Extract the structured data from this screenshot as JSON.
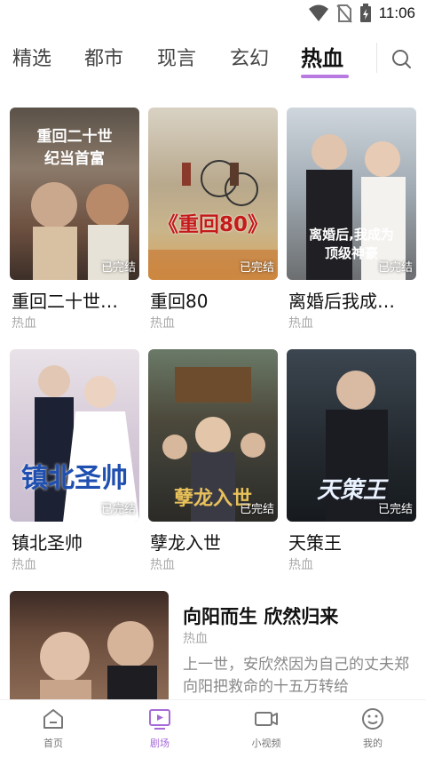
{
  "status": {
    "time": "11:06"
  },
  "tabs": [
    {
      "label": "精选"
    },
    {
      "label": "都市"
    },
    {
      "label": "现言"
    },
    {
      "label": "玄幻"
    },
    {
      "label": "热血"
    }
  ],
  "grid": [
    {
      "title": "重回二十世…",
      "tag": "热血",
      "badge": "已完结",
      "poster_text": "重回二十世纪当首富"
    },
    {
      "title": "重回80",
      "tag": "热血",
      "badge": "已完结",
      "poster_text": "《重回80》"
    },
    {
      "title": "离婚后我成…",
      "tag": "热血",
      "badge": "已完结",
      "poster_text": "离婚后,我成为顶级神豪"
    },
    {
      "title": "镇北圣帅",
      "tag": "热血",
      "badge": "已完结",
      "poster_text": "镇北圣帅"
    },
    {
      "title": "孽龙入世",
      "tag": "热血",
      "badge": "已完结",
      "poster_text": "孽龙入世"
    },
    {
      "title": "天策王",
      "tag": "热血",
      "badge": "已完结",
      "poster_text": "天策王"
    }
  ],
  "featured": {
    "title": "向阳而生 欣然归来",
    "tag": "热血",
    "description": "上一世，安欣然因为自己的丈夫郑向阳把救命的十五万转给"
  },
  "bottom_nav": [
    {
      "label": "首页",
      "icon": "home-icon"
    },
    {
      "label": "剧场",
      "icon": "theater-icon"
    },
    {
      "label": "小视频",
      "icon": "video-camera-icon"
    },
    {
      "label": "我的",
      "icon": "smiley-face-icon"
    }
  ],
  "colors": {
    "accent": "#a56ad8",
    "tab_underline": "#b87ae0"
  }
}
